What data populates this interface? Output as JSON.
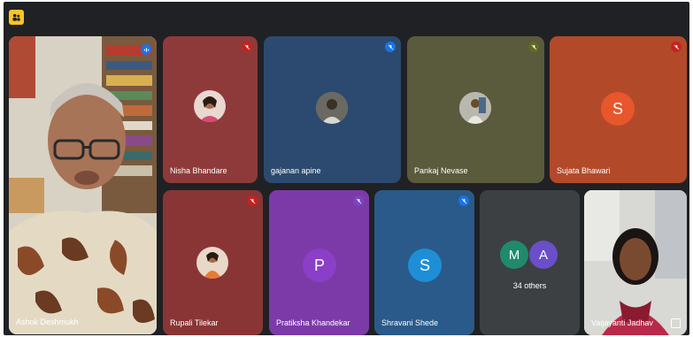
{
  "app": {
    "icon": "people-icon"
  },
  "participants": {
    "speaker": {
      "name": "Ashok Deshmukh"
    },
    "tiles": [
      {
        "name": "Nisha Bhandare",
        "mic_color": "#c5221f"
      },
      {
        "name": "gajanan apine",
        "mic_color": "#1a73e8"
      },
      {
        "name": "Pankaj Nevase",
        "mic_color": "#606a25"
      },
      {
        "name": "Sujata Bhawari",
        "initial": "S",
        "mic_color": "#c5221f",
        "avatar_color": "#e8562c"
      },
      {
        "name": "Rupali Tilekar",
        "mic_color": "#c5221f"
      },
      {
        "name": "Pratiksha Khandekar",
        "initial": "P",
        "mic_color": "#7a44c2",
        "avatar_color": "#8b3fc7"
      },
      {
        "name": "Shravani Shede",
        "initial": "S",
        "mic_color": "#1a73e8",
        "avatar_color": "#1e8fd6"
      }
    ],
    "others": {
      "initials": [
        "M",
        "A"
      ],
      "label": "34 others",
      "colors": [
        "#1f8a6e",
        "#6a4fc9"
      ]
    },
    "self": {
      "name": "Vaijayanti Jadhav"
    }
  },
  "colors": {
    "background": "#202124",
    "tile_nisha": "#8f3a3a",
    "tile_gajanan": "#2c4a6f",
    "tile_pankaj": "#5a5a3c",
    "tile_sujata": "#b24a2a",
    "tile_rupali": "#8a3535",
    "tile_pratiksha": "#7b3aa8",
    "tile_shravani": "#2a5a89",
    "tile_others": "#3c4043"
  }
}
